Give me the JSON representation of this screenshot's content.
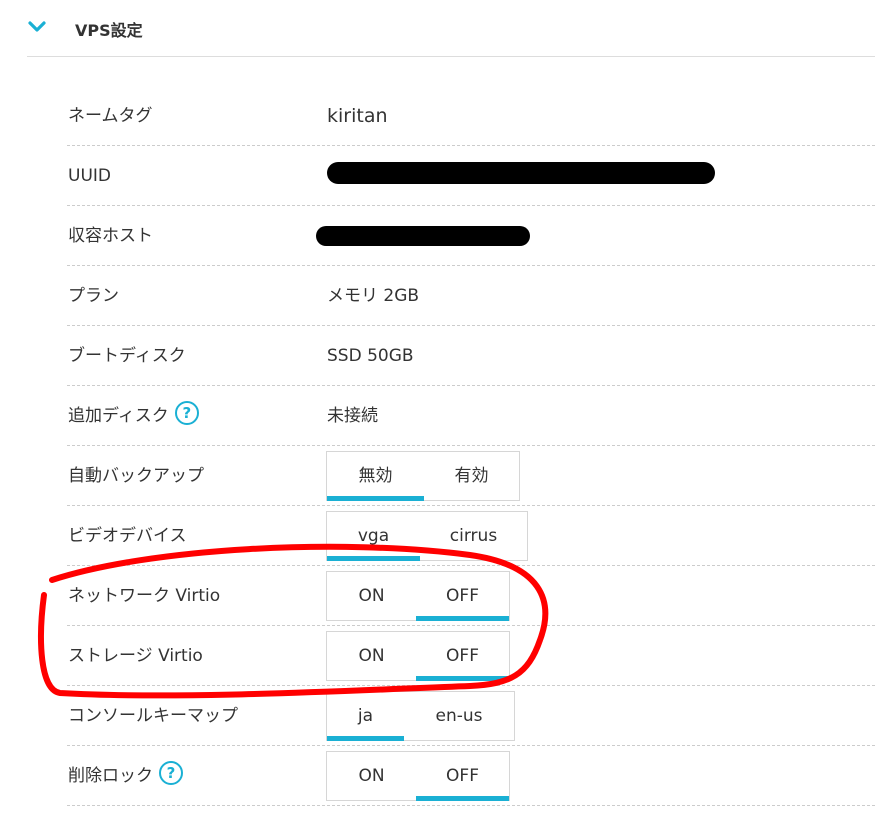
{
  "section": {
    "title": "VPS設定",
    "icon": "chevron-down-icon"
  },
  "colors": {
    "accent": "#1ab0d4",
    "annotation": "#ff0000",
    "separator": "#cccccc"
  },
  "rows": {
    "nametag": {
      "label": "ネームタグ",
      "value": "kiritan"
    },
    "uuid": {
      "label": "UUID",
      "value_redacted": true
    },
    "host": {
      "label": "収容ホスト",
      "value_redacted": true
    },
    "plan": {
      "label": "プラン",
      "value": "メモリ 2GB"
    },
    "boot_disk": {
      "label": "ブートディスク",
      "value": "SSD 50GB"
    },
    "extra_disk": {
      "label": "追加ディスク",
      "help": "?",
      "value": "未接続"
    },
    "auto_backup": {
      "label": "自動バックアップ",
      "options": [
        "無効",
        "有効"
      ],
      "selected": "無効"
    },
    "video_device": {
      "label": "ビデオデバイス",
      "options": [
        "vga",
        "cirrus"
      ],
      "selected": "vga"
    },
    "network_virtio": {
      "label": "ネットワーク Virtio",
      "options": [
        "ON",
        "OFF"
      ],
      "selected": "OFF"
    },
    "storage_virtio": {
      "label": "ストレージ Virtio",
      "options": [
        "ON",
        "OFF"
      ],
      "selected": "OFF"
    },
    "console_keymap": {
      "label": "コンソールキーマップ",
      "options": [
        "ja",
        "en-us"
      ],
      "selected": "ja"
    },
    "delete_lock": {
      "label": "削除ロック",
      "help": "?",
      "options": [
        "ON",
        "OFF"
      ],
      "selected": "OFF"
    }
  }
}
